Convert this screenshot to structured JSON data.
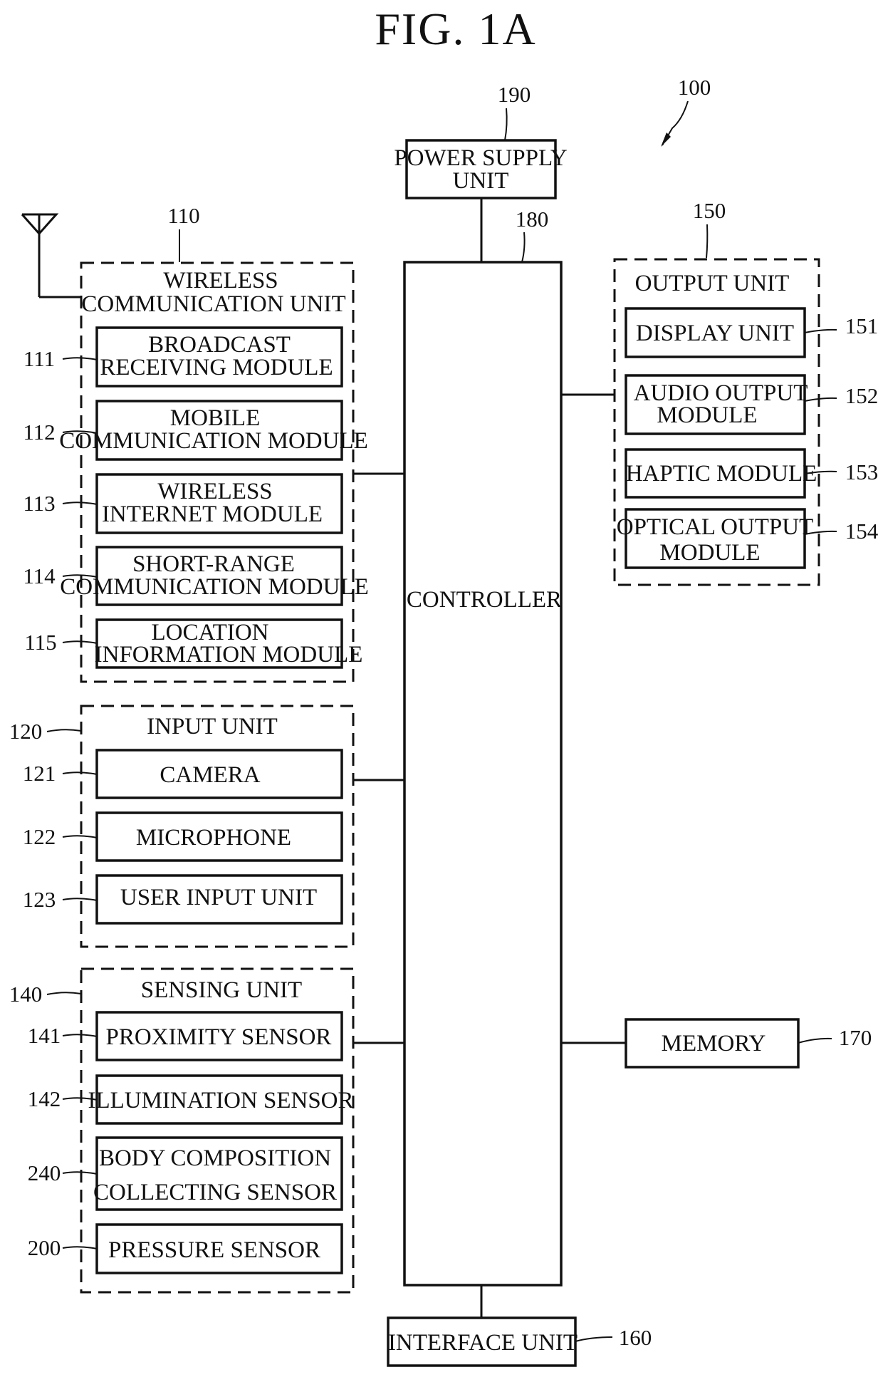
{
  "figure": {
    "title": "FIG. 1A",
    "device_ref": "100"
  },
  "power_supply": {
    "ref": "190",
    "lines": [
      "POWER SUPPLY",
      "UNIT"
    ]
  },
  "controller": {
    "ref": "180",
    "label": "CONTROLLER"
  },
  "wireless_unit": {
    "ref": "110",
    "lines": [
      "WIRELESS",
      "COMMUNICATION UNIT"
    ],
    "modules": [
      {
        "ref": "111",
        "lines": [
          "BROADCAST",
          "RECEIVING MODULE"
        ]
      },
      {
        "ref": "112",
        "lines": [
          "MOBILE",
          "COMMUNICATION MODULE"
        ]
      },
      {
        "ref": "113",
        "lines": [
          "WIRELESS",
          "INTERNET MODULE"
        ]
      },
      {
        "ref": "114",
        "lines": [
          "SHORT-RANGE",
          "COMMUNICATION MODULE"
        ]
      },
      {
        "ref": "115",
        "lines": [
          "LOCATION",
          "INFORMATION MODULE"
        ]
      }
    ]
  },
  "input_unit": {
    "ref": "120",
    "label": "INPUT UNIT",
    "modules": [
      {
        "ref": "121",
        "label": "CAMERA"
      },
      {
        "ref": "122",
        "label": "MICROPHONE"
      },
      {
        "ref": "123",
        "label": "USER INPUT UNIT"
      }
    ]
  },
  "sensing_unit": {
    "ref": "140",
    "label": "SENSING UNIT",
    "modules": [
      {
        "ref": "141",
        "lines": [
          "PROXIMITY SENSOR"
        ]
      },
      {
        "ref": "142",
        "lines": [
          "ILLUMINATION SENSOR"
        ]
      },
      {
        "ref": "240",
        "lines": [
          "BODY COMPOSITION",
          "COLLECTING SENSOR"
        ]
      },
      {
        "ref": "200",
        "lines": [
          "PRESSURE SENSOR"
        ]
      }
    ]
  },
  "output_unit": {
    "ref": "150",
    "label": "OUTPUT UNIT",
    "modules": [
      {
        "ref": "151",
        "lines": [
          "DISPLAY UNIT"
        ]
      },
      {
        "ref": "152",
        "lines": [
          "AUDIO OUTPUT",
          "MODULE"
        ]
      },
      {
        "ref": "153",
        "lines": [
          "HAPTIC MODULE"
        ]
      },
      {
        "ref": "154",
        "lines": [
          "OPTICAL OUTPUT",
          "MODULE"
        ]
      }
    ]
  },
  "memory": {
    "ref": "170",
    "label": "MEMORY"
  },
  "interface_unit": {
    "ref": "160",
    "label": "INTERFACE UNIT"
  }
}
